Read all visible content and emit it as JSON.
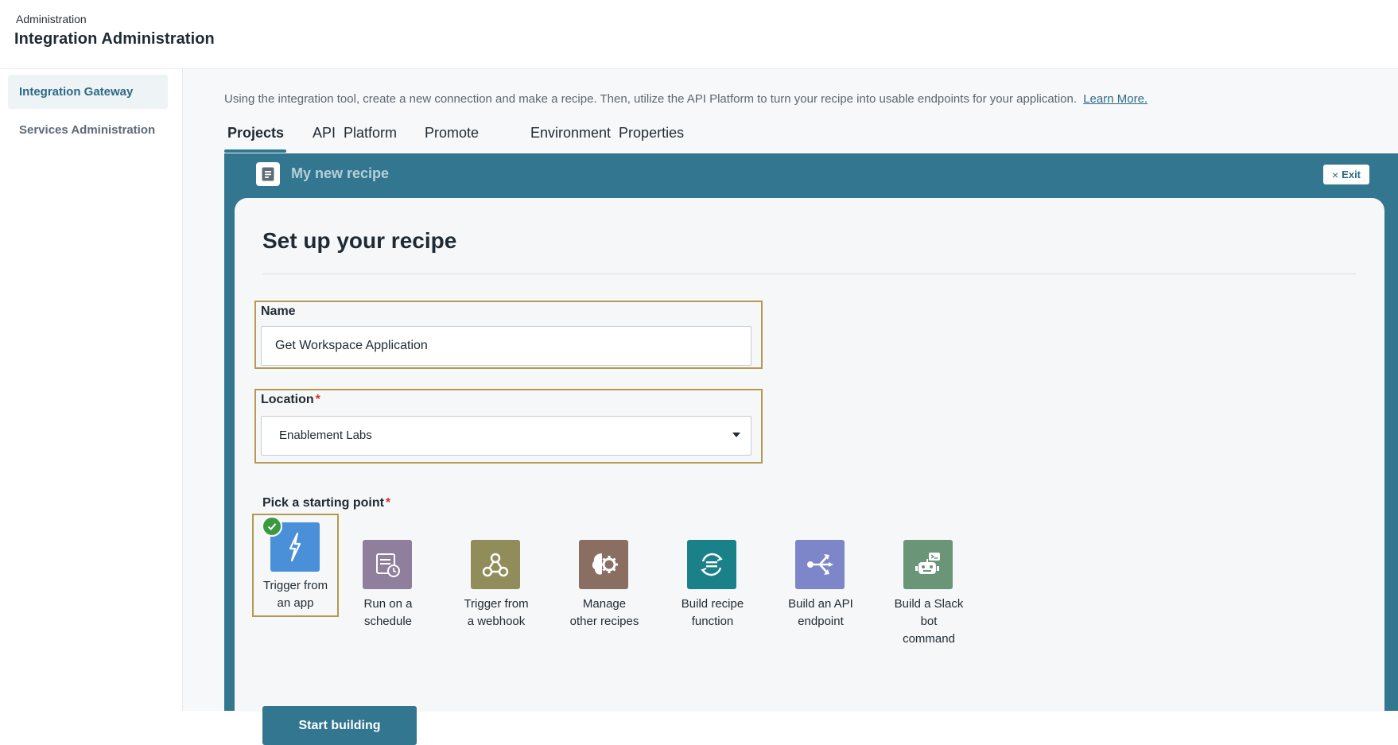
{
  "header": {
    "breadcrumb": "Administration",
    "title": "Integration Administration"
  },
  "sidebar": {
    "items": [
      {
        "label": "Integration Gateway",
        "active": true
      },
      {
        "label": "Services Administration",
        "active": false
      }
    ]
  },
  "intro": {
    "text": "Using the integration tool, create a new connection and make a recipe. Then, utilize the API Platform to turn your recipe into usable endpoints for your application.",
    "link": "Learn More."
  },
  "tabs": [
    {
      "label": "Projects",
      "active": true
    },
    {
      "label": "API  Platform",
      "active": false
    },
    {
      "label": "Promote",
      "active": false
    },
    {
      "label": "Environment  Properties",
      "active": false
    }
  ],
  "panel": {
    "title": "My new recipe",
    "exit_label": "Exit",
    "icon": "recipe-document-icon"
  },
  "form": {
    "heading": "Set up your recipe",
    "name_label": "Name",
    "name_value": "Get Workspace Application",
    "location_label": "Location",
    "location_value": "Enablement Labs",
    "required_mark": "*",
    "pick_label": "Pick a starting point",
    "start_button": "Start building"
  },
  "starting_points": [
    {
      "line1": "Trigger from",
      "line2": "an app",
      "color": "#4a90d9",
      "icon": "lightning-bolt-icon",
      "selected": true
    },
    {
      "line1": "Run on a",
      "line2": "schedule",
      "color": "#8f7f9c",
      "icon": "schedule-clock-icon",
      "selected": false
    },
    {
      "line1": "Trigger from",
      "line2": "a webhook",
      "color": "#918d5a",
      "icon": "webhook-icon",
      "selected": false
    },
    {
      "line1": "Manage",
      "line2": "other recipes",
      "color": "#8a6e62",
      "icon": "brain-gear-icon",
      "selected": false
    },
    {
      "line1": "Build recipe",
      "line2": "function",
      "color": "#1a8189",
      "icon": "function-sync-icon",
      "selected": false
    },
    {
      "line1": "Build an API",
      "line2": "endpoint",
      "color": "#7d86c9",
      "icon": "api-endpoint-icon",
      "selected": false
    },
    {
      "line1": "Build a Slack",
      "line2": "bot",
      "line3": "command",
      "color": "#6a9577",
      "icon": "slack-bot-icon",
      "selected": false
    }
  ],
  "colors": {
    "accent": "#32768f",
    "selection_outline": "#b49a4f",
    "success": "#3a9a3f",
    "required": "#d0362b"
  }
}
